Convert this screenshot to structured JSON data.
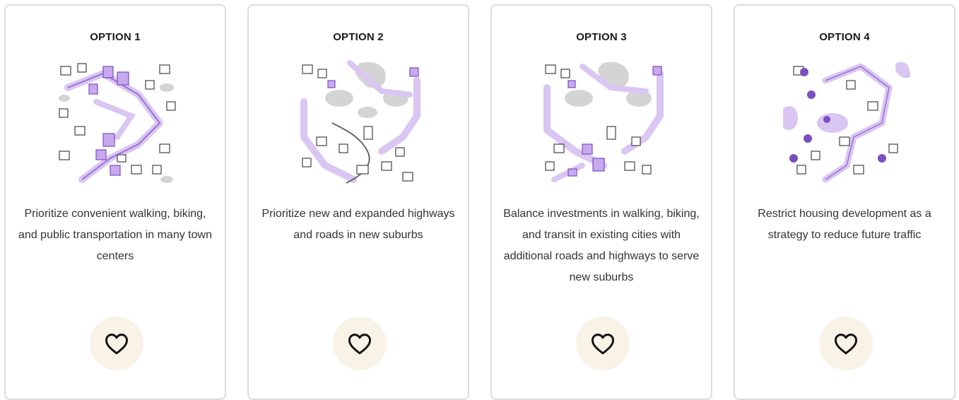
{
  "options": [
    {
      "title": "OPTION 1",
      "description": "Prioritize convenient walking, biking, and public transportation in many town centers",
      "like_icon": "heart-icon"
    },
    {
      "title": "OPTION 2",
      "description": "Prioritize new and expanded highways and roads in new suburbs",
      "like_icon": "heart-icon"
    },
    {
      "title": "OPTION 3",
      "description": "Balance investments in walking, biking, and transit in existing cities with additional roads and highways to serve new suburbs",
      "like_icon": "heart-icon"
    },
    {
      "title": "OPTION 4",
      "description": "Restrict housing development as a strategy to reduce future traffic",
      "like_icon": "heart-icon"
    }
  ],
  "colors": {
    "accent_purple": "#9b6fd6",
    "light_purple": "#d9c6f2",
    "gray_area": "#d4d4d4",
    "like_bg": "#f9f2e6",
    "card_border": "#dcdcdc"
  }
}
